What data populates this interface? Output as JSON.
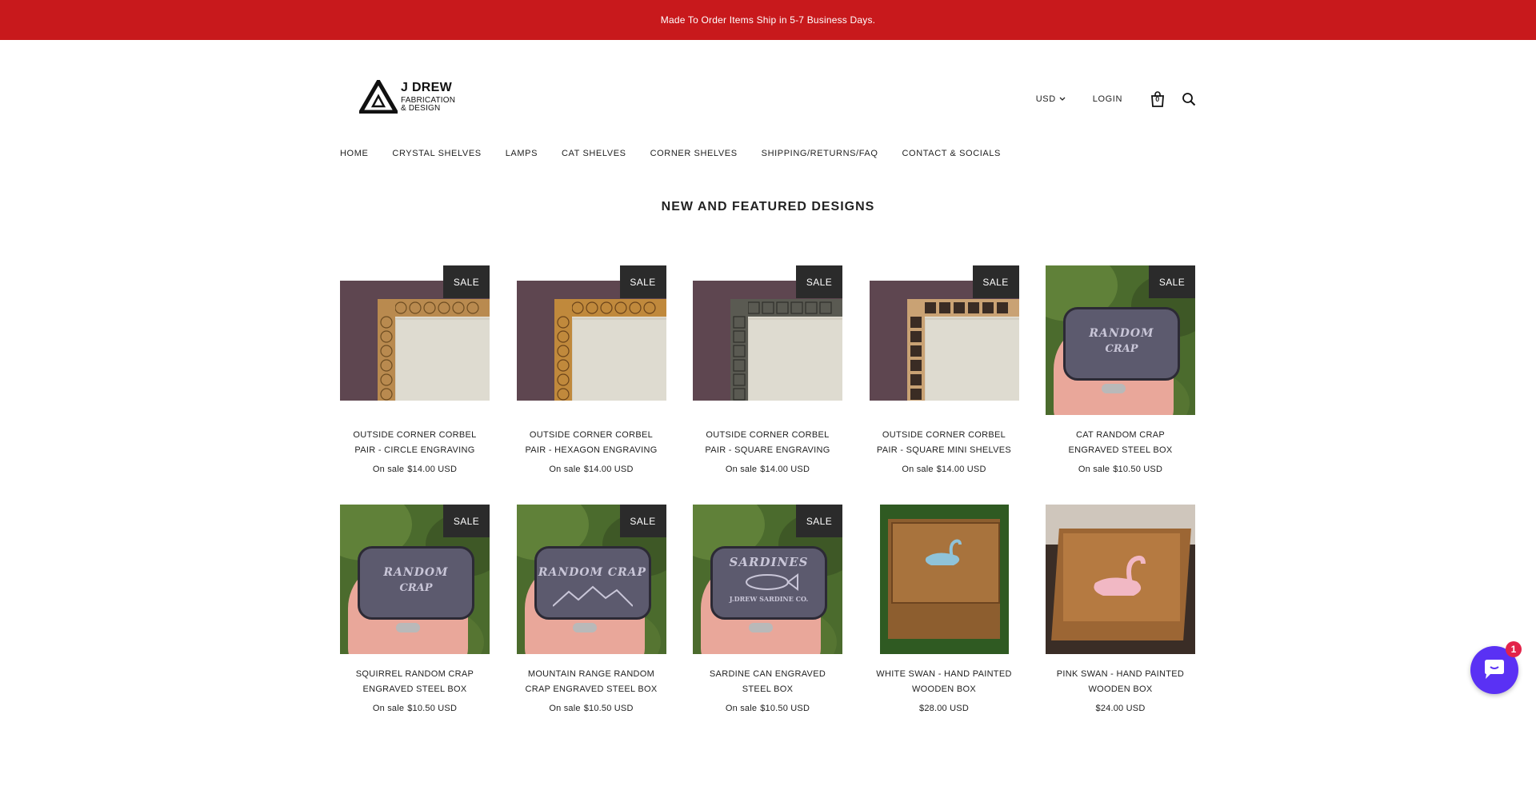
{
  "announcement": "Made To Order Items Ship in 5-7 Business Days.",
  "brand": {
    "name": "J DREW",
    "line1": "FABRICATION",
    "line2": "& DESIGN"
  },
  "header": {
    "currency": "USD",
    "login": "LOGIN",
    "cart_count": "0"
  },
  "nav": [
    {
      "label": "HOME"
    },
    {
      "label": "CRYSTAL SHELVES"
    },
    {
      "label": "LAMPS"
    },
    {
      "label": "CAT SHELVES"
    },
    {
      "label": "CORNER SHELVES"
    },
    {
      "label": "SHIPPING/RETURNS/FAQ"
    },
    {
      "label": "CONTACT & SOCIALS"
    }
  ],
  "section_title": "NEW AND FEATURED DESIGNS",
  "sale_label": "SALE",
  "products": [
    {
      "title": "OUTSIDE CORNER CORBEL PAIR - CIRCLE ENGRAVING",
      "on_sale": "On sale",
      "price": "$14.00 USD"
    },
    {
      "title": "OUTSIDE CORNER CORBEL PAIR - HEXAGON ENGRAVING",
      "on_sale": "On sale",
      "price": "$14.00 USD"
    },
    {
      "title": "OUTSIDE CORNER CORBEL PAIR - SQUARE ENGRAVING",
      "on_sale": "On sale",
      "price": "$14.00 USD"
    },
    {
      "title": "OUTSIDE CORNER CORBEL PAIR - SQUARE MINI SHELVES",
      "on_sale": "On sale",
      "price": "$14.00 USD"
    },
    {
      "title": "CAT RANDOM CRAP ENGRAVED STEEL BOX",
      "on_sale": "On sale",
      "price": "$10.50 USD",
      "engraving": [
        "RANDOM",
        "CRAP"
      ]
    },
    {
      "title": "SQUIRREL RANDOM CRAP ENGRAVED STEEL BOX",
      "on_sale": "On sale",
      "price": "$10.50 USD",
      "engraving": [
        "RANDOM",
        "CRAP"
      ]
    },
    {
      "title": "MOUNTAIN RANGE RANDOM CRAP ENGRAVED STEEL BOX",
      "on_sale": "On sale",
      "price": "$10.50 USD",
      "engraving": [
        "RANDOM CRAP",
        ""
      ]
    },
    {
      "title": "SARDINE CAN ENGRAVED STEEL BOX",
      "on_sale": "On sale",
      "price": "$10.50 USD",
      "engraving": [
        "SARDINES",
        "J.DREW SARDINE CO."
      ]
    },
    {
      "title": "WHITE SWAN - HAND PAINTED WOODEN BOX",
      "price": "$28.00 USD"
    },
    {
      "title": "PINK SWAN - HAND PAINTED WOODEN BOX",
      "price": "$24.00 USD"
    }
  ],
  "chat": {
    "badge": "1"
  },
  "colors": {
    "announcement_bg": "#c8191c",
    "sale_badge_bg": "#2b2b2b",
    "chat_button": "#5a31f4",
    "chat_badge": "#e3234a"
  }
}
